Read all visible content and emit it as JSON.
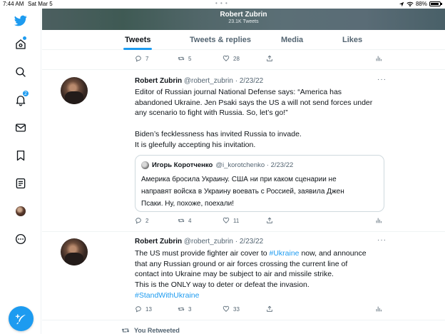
{
  "status_bar": {
    "time": "7:44 AM",
    "date": "Sat Mar 5",
    "dots": "• • •",
    "battery": "88%"
  },
  "sidebar": {
    "notifications_badge": "2",
    "items": [
      "twitter-logo",
      "home",
      "explore",
      "notifications",
      "messages",
      "bookmarks",
      "lists",
      "profile",
      "more"
    ]
  },
  "header": {
    "name": "Robert Zubrin",
    "tweet_count": "23.1K Tweets"
  },
  "tabs": [
    {
      "label": "Tweets",
      "active": true
    },
    {
      "label": "Tweets & replies",
      "active": false
    },
    {
      "label": "Media",
      "active": false
    },
    {
      "label": "Likes",
      "active": false
    }
  ],
  "top_actions": {
    "replies": "7",
    "retweets": "5",
    "likes": "28"
  },
  "tweets": [
    {
      "name": "Robert Zubrin",
      "handle_date": "@robert_zubrin · 2/23/22",
      "lines": [
        "Editor of Russian journal National Defense says: “America has",
        "abandoned Ukraine. Jen Psaki says the US a will not send forces under",
        "any scenario to fight with Russia. So, let’s go!”",
        "",
        "Biden’s fecklessness has invited Russia to invade.",
        "It is gleefully accepting his invitation."
      ],
      "quote": {
        "name": "Игорь Коротченко",
        "handle_date": "@i_korotchenko · 2/23/22",
        "lines": [
          "Америка бросила Украину. США ни при каком сценарии не",
          "направят войска в Украину воевать с Россией, заявила Джен",
          "Псаки. Ну, похоже, поехали!"
        ]
      },
      "actions": {
        "replies": "2",
        "retweets": "4",
        "likes": "11"
      }
    },
    {
      "name": "Robert Zubrin",
      "handle_date": "@robert_zubrin · 2/23/22",
      "line1_pre": "The US must provide fighter air cover to ",
      "line1_link": "#Ukraine",
      "line1_post": " now, and announce",
      "lines": [
        "that any Russian ground or air forces crossing the current line of",
        "contact into Ukraine may be subject to air and missile strike.",
        "This is the ONLY way to deter or defeat the invasion."
      ],
      "hashtag": "#StandWithUkraine",
      "actions": {
        "replies": "13",
        "retweets": "3",
        "likes": "33"
      }
    }
  ],
  "retweet_note": "You Retweeted",
  "colors": {
    "accent": "#1d9bf0",
    "text": "#0f1419",
    "muted": "#536471",
    "border": "#eff3f4"
  }
}
